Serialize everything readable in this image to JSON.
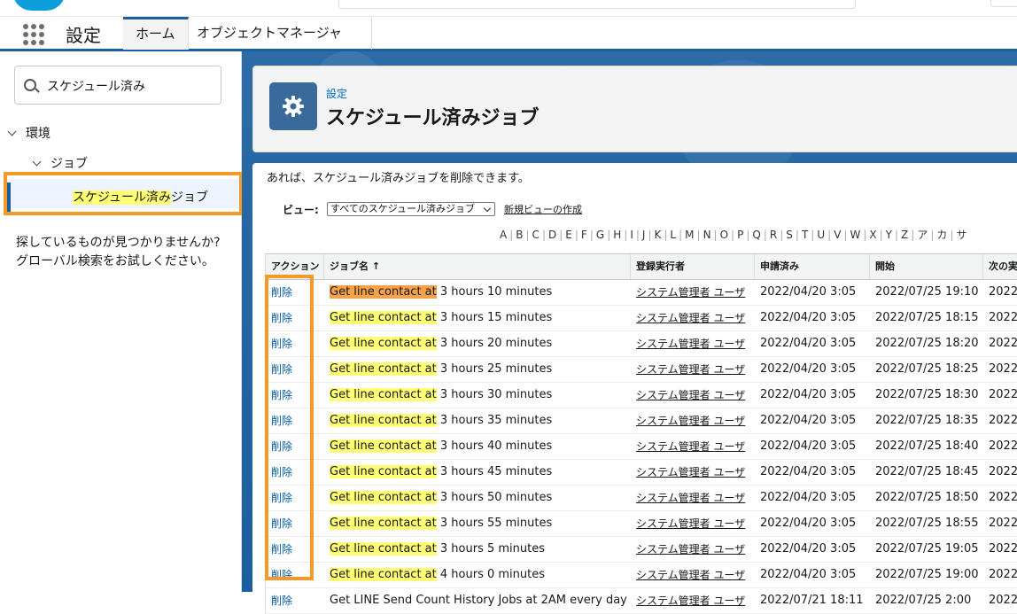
{
  "nav": {
    "app_title": "設定",
    "tabs": [
      {
        "label": "ホーム"
      },
      {
        "label": "オブジェクトマネージャ"
      }
    ]
  },
  "sidebar": {
    "search_value": "スケジュール済み",
    "tree": {
      "env": "環境",
      "jobs": "ジョブ",
      "selected_highlight": "スケジュール済み",
      "selected_rest": "ジョブ"
    },
    "help_line1": "探しているものが見つかりませんか?",
    "help_line2": "グローバル検索をお試しください。"
  },
  "header": {
    "breadcrumb": "設定",
    "title": "スケジュール済みジョブ",
    "icon": "gear-icon"
  },
  "content": {
    "description": "あれば、スケジュール済みジョブを削除できます。",
    "view_label": "ビュー:",
    "view_selected": "すべてのスケジュール済みジョブ",
    "new_view_link": "新規ビューの作成",
    "alphabet": [
      "A",
      "B",
      "C",
      "D",
      "E",
      "F",
      "G",
      "H",
      "I",
      "J",
      "K",
      "L",
      "M",
      "N",
      "O",
      "P",
      "Q",
      "R",
      "S",
      "T",
      "U",
      "V",
      "W",
      "X",
      "Y",
      "Z",
      "ア",
      "カ",
      "サ"
    ]
  },
  "table": {
    "headers": {
      "action": "アクション",
      "job_name": "ジョブ名 ↑",
      "submitted_by": "登録実行者",
      "submitted": "申請済み",
      "started": "開始",
      "next": "次の実"
    },
    "rows": [
      {
        "action": "削除",
        "hl": "Get line contact at",
        "rest": " 3 hours 10 minutes",
        "user": "システム管理者 ユーザ",
        "submitted": "2022/04/20 3:05",
        "started": "2022/07/25 19:10",
        "next": "2022"
      },
      {
        "action": "削除",
        "hl": "Get line contact at",
        "rest": " 3 hours 15 minutes",
        "user": "システム管理者 ユーザ",
        "submitted": "2022/04/20 3:05",
        "started": "2022/07/25 18:15",
        "next": "2022"
      },
      {
        "action": "削除",
        "hl": "Get line contact at",
        "rest": " 3 hours 20 minutes",
        "user": "システム管理者 ユーザ",
        "submitted": "2022/04/20 3:05",
        "started": "2022/07/25 18:20",
        "next": "2022"
      },
      {
        "action": "削除",
        "hl": "Get line contact at",
        "rest": " 3 hours 25 minutes",
        "user": "システム管理者 ユーザ",
        "submitted": "2022/04/20 3:05",
        "started": "2022/07/25 18:25",
        "next": "2022"
      },
      {
        "action": "削除",
        "hl": "Get line contact at",
        "rest": " 3 hours 30 minutes",
        "user": "システム管理者 ユーザ",
        "submitted": "2022/04/20 3:05",
        "started": "2022/07/25 18:30",
        "next": "2022"
      },
      {
        "action": "削除",
        "hl": "Get line contact at",
        "rest": " 3 hours 35 minutes",
        "user": "システム管理者 ユーザ",
        "submitted": "2022/04/20 3:05",
        "started": "2022/07/25 18:35",
        "next": "2022"
      },
      {
        "action": "削除",
        "hl": "Get line contact at",
        "rest": " 3 hours 40 minutes",
        "user": "システム管理者 ユーザ",
        "submitted": "2022/04/20 3:05",
        "started": "2022/07/25 18:40",
        "next": "2022"
      },
      {
        "action": "削除",
        "hl": "Get line contact at",
        "rest": " 3 hours 45 minutes",
        "user": "システム管理者 ユーザ",
        "submitted": "2022/04/20 3:05",
        "started": "2022/07/25 18:45",
        "next": "2022"
      },
      {
        "action": "削除",
        "hl": "Get line contact at",
        "rest": " 3 hours 50 minutes",
        "user": "システム管理者 ユーザ",
        "submitted": "2022/04/20 3:05",
        "started": "2022/07/25 18:50",
        "next": "2022"
      },
      {
        "action": "削除",
        "hl": "Get line contact at",
        "rest": " 3 hours 55 minutes",
        "user": "システム管理者 ユーザ",
        "submitted": "2022/04/20 3:05",
        "started": "2022/07/25 18:55",
        "next": "2022"
      },
      {
        "action": "削除",
        "hl": "Get line contact at",
        "rest": " 3 hours 5 minutes",
        "user": "システム管理者 ユーザ",
        "submitted": "2022/04/20 3:05",
        "started": "2022/07/25 19:05",
        "next": "2022"
      },
      {
        "action": "削除",
        "hl": "Get line contact at",
        "rest": " 4 hours 0 minutes",
        "user": "システム管理者 ユーザ",
        "submitted": "2022/04/20 3:05",
        "started": "2022/07/25 19:00",
        "next": "2022"
      },
      {
        "action": "削除",
        "hl": "",
        "rest": "Get LINE Send Count History Jobs at 2AM every day",
        "user": "システム管理者 ユーザ",
        "submitted": "2022/07/21 18:11",
        "started": "2022/07/25 2:00",
        "next": "2022"
      }
    ]
  },
  "colors": {
    "brand_blue": "#1b5f9e",
    "annotation_orange": "#f39a28",
    "highlight_yellow": "#ffff75",
    "highlight_orange": "#f6a24b",
    "link_blue": "#015ba7"
  }
}
